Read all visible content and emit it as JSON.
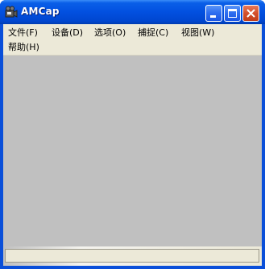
{
  "window": {
    "title": "AMCap",
    "icon": "camera-icon"
  },
  "caption_buttons": {
    "minimize_icon": "minimize-icon",
    "maximize_icon": "maximize-icon",
    "close_icon": "close-icon"
  },
  "menu": {
    "items": [
      {
        "label": "文件(F)"
      },
      {
        "label": "设备(D)"
      },
      {
        "label": "选项(O)"
      },
      {
        "label": "捕捉(C)"
      },
      {
        "label": "视图(W)"
      },
      {
        "label": "帮助(H)"
      }
    ]
  },
  "status": {
    "text": ""
  },
  "colors": {
    "titlebar": "#0250e0",
    "menubar": "#ece9d8",
    "preview_area": "#c0c0c0",
    "close_button": "#d4502c"
  }
}
